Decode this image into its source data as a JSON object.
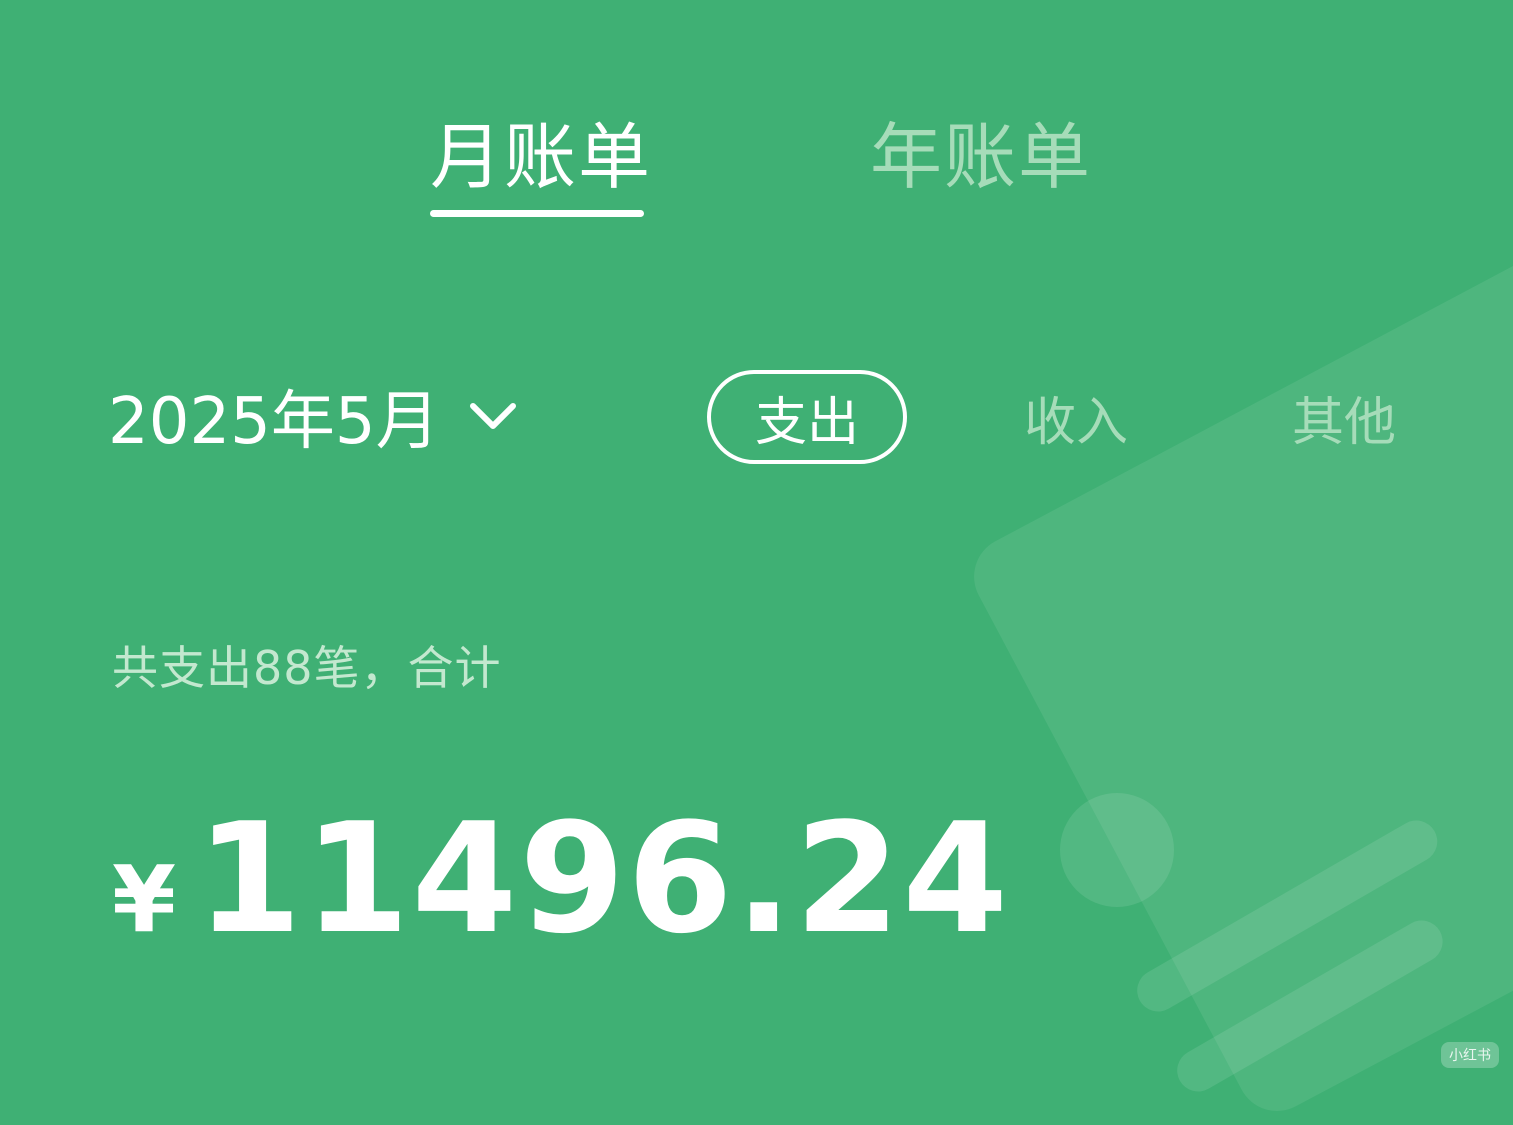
{
  "tabs": {
    "monthly": "月账单",
    "yearly": "年账单"
  },
  "period": {
    "label": "2025年5月",
    "icon": "chevron-down-icon"
  },
  "filters": {
    "expense": "支出",
    "income": "收入",
    "other": "其他"
  },
  "summary": {
    "text": "共支出88笔，合计",
    "currency": "¥",
    "amount": "11496.24"
  },
  "watermark": "小红书",
  "colors": {
    "background": "#3fb074",
    "inactive_text": "#a6dcb9",
    "active_text": "#ffffff"
  }
}
